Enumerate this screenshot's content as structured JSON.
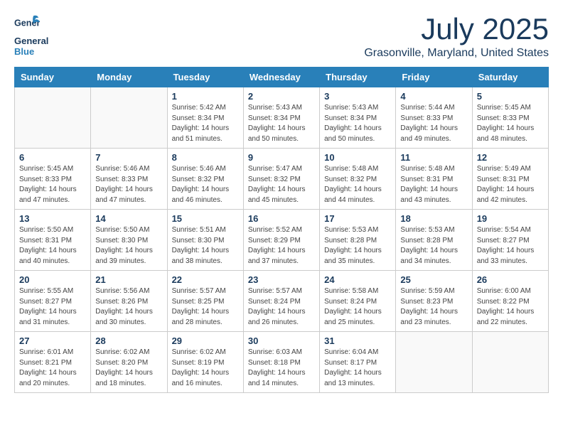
{
  "header": {
    "logo_general": "General",
    "logo_blue": "Blue",
    "month_year": "July 2025",
    "location": "Grasonville, Maryland, United States"
  },
  "days_of_week": [
    "Sunday",
    "Monday",
    "Tuesday",
    "Wednesday",
    "Thursday",
    "Friday",
    "Saturday"
  ],
  "weeks": [
    [
      {
        "day": "",
        "info": ""
      },
      {
        "day": "",
        "info": ""
      },
      {
        "day": "1",
        "info": "Sunrise: 5:42 AM\nSunset: 8:34 PM\nDaylight: 14 hours and 51 minutes."
      },
      {
        "day": "2",
        "info": "Sunrise: 5:43 AM\nSunset: 8:34 PM\nDaylight: 14 hours and 50 minutes."
      },
      {
        "day": "3",
        "info": "Sunrise: 5:43 AM\nSunset: 8:34 PM\nDaylight: 14 hours and 50 minutes."
      },
      {
        "day": "4",
        "info": "Sunrise: 5:44 AM\nSunset: 8:33 PM\nDaylight: 14 hours and 49 minutes."
      },
      {
        "day": "5",
        "info": "Sunrise: 5:45 AM\nSunset: 8:33 PM\nDaylight: 14 hours and 48 minutes."
      }
    ],
    [
      {
        "day": "6",
        "info": "Sunrise: 5:45 AM\nSunset: 8:33 PM\nDaylight: 14 hours and 47 minutes."
      },
      {
        "day": "7",
        "info": "Sunrise: 5:46 AM\nSunset: 8:33 PM\nDaylight: 14 hours and 47 minutes."
      },
      {
        "day": "8",
        "info": "Sunrise: 5:46 AM\nSunset: 8:32 PM\nDaylight: 14 hours and 46 minutes."
      },
      {
        "day": "9",
        "info": "Sunrise: 5:47 AM\nSunset: 8:32 PM\nDaylight: 14 hours and 45 minutes."
      },
      {
        "day": "10",
        "info": "Sunrise: 5:48 AM\nSunset: 8:32 PM\nDaylight: 14 hours and 44 minutes."
      },
      {
        "day": "11",
        "info": "Sunrise: 5:48 AM\nSunset: 8:31 PM\nDaylight: 14 hours and 43 minutes."
      },
      {
        "day": "12",
        "info": "Sunrise: 5:49 AM\nSunset: 8:31 PM\nDaylight: 14 hours and 42 minutes."
      }
    ],
    [
      {
        "day": "13",
        "info": "Sunrise: 5:50 AM\nSunset: 8:31 PM\nDaylight: 14 hours and 40 minutes."
      },
      {
        "day": "14",
        "info": "Sunrise: 5:50 AM\nSunset: 8:30 PM\nDaylight: 14 hours and 39 minutes."
      },
      {
        "day": "15",
        "info": "Sunrise: 5:51 AM\nSunset: 8:30 PM\nDaylight: 14 hours and 38 minutes."
      },
      {
        "day": "16",
        "info": "Sunrise: 5:52 AM\nSunset: 8:29 PM\nDaylight: 14 hours and 37 minutes."
      },
      {
        "day": "17",
        "info": "Sunrise: 5:53 AM\nSunset: 8:28 PM\nDaylight: 14 hours and 35 minutes."
      },
      {
        "day": "18",
        "info": "Sunrise: 5:53 AM\nSunset: 8:28 PM\nDaylight: 14 hours and 34 minutes."
      },
      {
        "day": "19",
        "info": "Sunrise: 5:54 AM\nSunset: 8:27 PM\nDaylight: 14 hours and 33 minutes."
      }
    ],
    [
      {
        "day": "20",
        "info": "Sunrise: 5:55 AM\nSunset: 8:27 PM\nDaylight: 14 hours and 31 minutes."
      },
      {
        "day": "21",
        "info": "Sunrise: 5:56 AM\nSunset: 8:26 PM\nDaylight: 14 hours and 30 minutes."
      },
      {
        "day": "22",
        "info": "Sunrise: 5:57 AM\nSunset: 8:25 PM\nDaylight: 14 hours and 28 minutes."
      },
      {
        "day": "23",
        "info": "Sunrise: 5:57 AM\nSunset: 8:24 PM\nDaylight: 14 hours and 26 minutes."
      },
      {
        "day": "24",
        "info": "Sunrise: 5:58 AM\nSunset: 8:24 PM\nDaylight: 14 hours and 25 minutes."
      },
      {
        "day": "25",
        "info": "Sunrise: 5:59 AM\nSunset: 8:23 PM\nDaylight: 14 hours and 23 minutes."
      },
      {
        "day": "26",
        "info": "Sunrise: 6:00 AM\nSunset: 8:22 PM\nDaylight: 14 hours and 22 minutes."
      }
    ],
    [
      {
        "day": "27",
        "info": "Sunrise: 6:01 AM\nSunset: 8:21 PM\nDaylight: 14 hours and 20 minutes."
      },
      {
        "day": "28",
        "info": "Sunrise: 6:02 AM\nSunset: 8:20 PM\nDaylight: 14 hours and 18 minutes."
      },
      {
        "day": "29",
        "info": "Sunrise: 6:02 AM\nSunset: 8:19 PM\nDaylight: 14 hours and 16 minutes."
      },
      {
        "day": "30",
        "info": "Sunrise: 6:03 AM\nSunset: 8:18 PM\nDaylight: 14 hours and 14 minutes."
      },
      {
        "day": "31",
        "info": "Sunrise: 6:04 AM\nSunset: 8:17 PM\nDaylight: 14 hours and 13 minutes."
      },
      {
        "day": "",
        "info": ""
      },
      {
        "day": "",
        "info": ""
      }
    ]
  ]
}
